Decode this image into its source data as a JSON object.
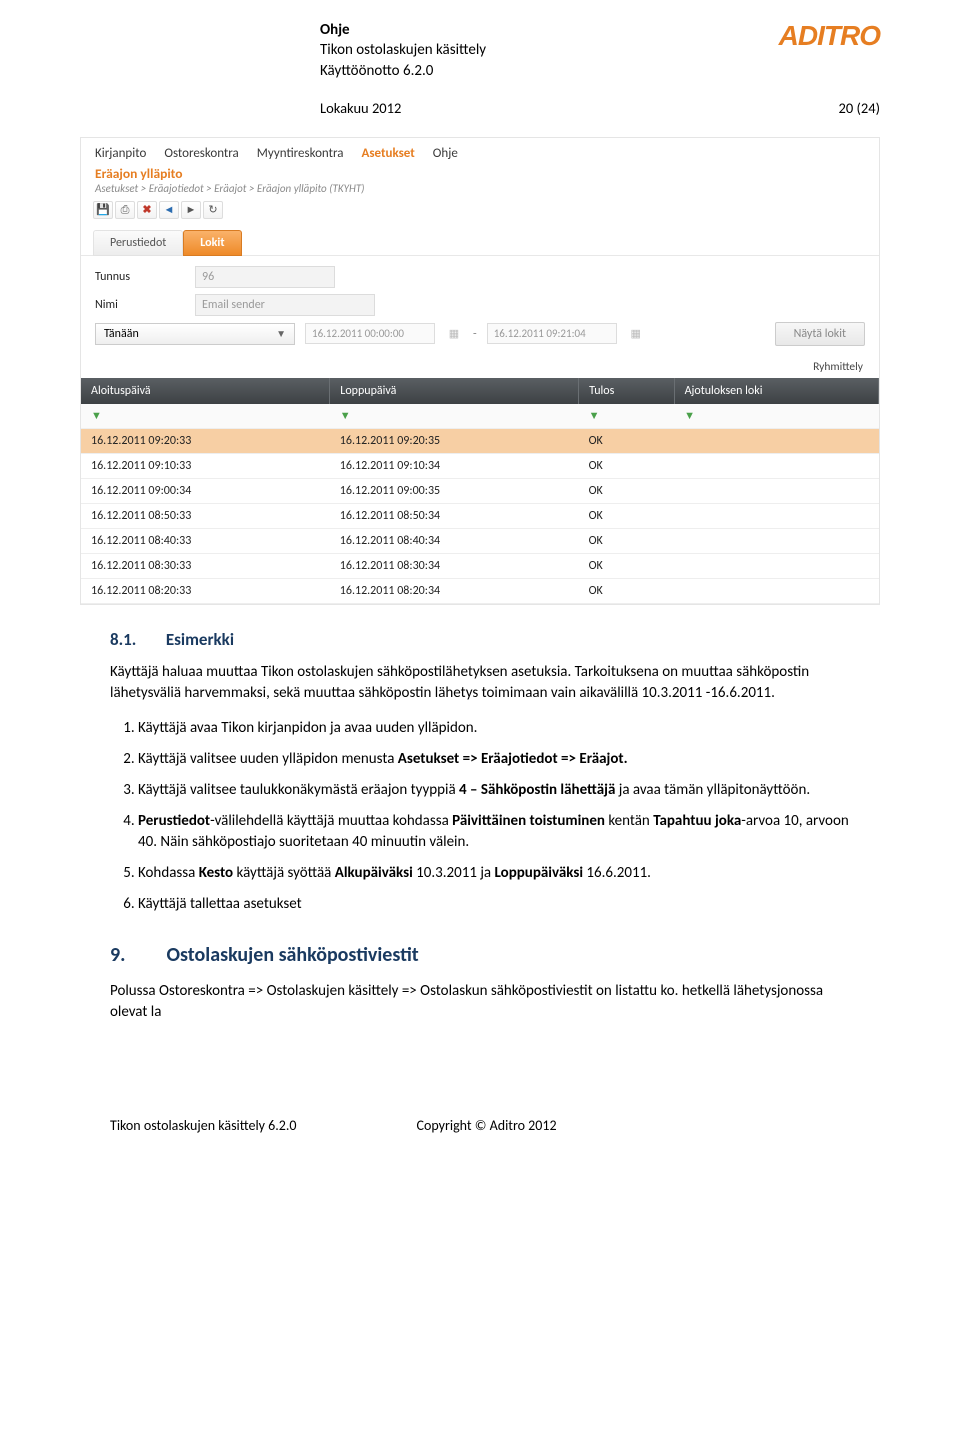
{
  "header": {
    "title": "Ohje",
    "line2": "Tikon ostolaskujen käsittely",
    "line3": "Käyttöönotto 6.2.0",
    "logo": "ADITRO",
    "date": "Lokakuu 2012",
    "pagenum": "20 (24)"
  },
  "app": {
    "menu": [
      "Kirjanpito",
      "Ostoreskontra",
      "Myyntireskontra",
      "Asetukset",
      "Ohje"
    ],
    "active_menu": "Asetukset",
    "screen_title": "Eräajon ylläpito",
    "breadcrumb": "Asetukset > Eräajotiedot > Eräajot > Eräajon ylläpito  (TKYHT)",
    "tabs": {
      "inactive": "Perustiedot",
      "active": "Lokit"
    },
    "form": {
      "tunnus_label": "Tunnus",
      "tunnus_value": "96",
      "nimi_label": "Nimi",
      "nimi_value": "Email sender",
      "range_option": "Tänään",
      "dt_from": "16.12.2011 00:00:00",
      "dt_to": "16.12.2011 09:21:04",
      "dash": "-",
      "show_button": "Näytä lokit",
      "grouping": "Ryhmittely"
    },
    "columns": [
      "Aloituspäivä",
      "Loppupäivä",
      "Tulos",
      "Ajotuloksen loki"
    ],
    "rows": [
      {
        "start": "16.12.2011 09:20:33",
        "end": "16.12.2011 09:20:35",
        "result": "OK",
        "selected": true
      },
      {
        "start": "16.12.2011 09:10:33",
        "end": "16.12.2011 09:10:34",
        "result": "OK"
      },
      {
        "start": "16.12.2011 09:00:34",
        "end": "16.12.2011 09:00:35",
        "result": "OK"
      },
      {
        "start": "16.12.2011 08:50:33",
        "end": "16.12.2011 08:50:34",
        "result": "OK"
      },
      {
        "start": "16.12.2011 08:40:33",
        "end": "16.12.2011 08:40:34",
        "result": "OK"
      },
      {
        "start": "16.12.2011 08:30:33",
        "end": "16.12.2011 08:30:34",
        "result": "OK"
      },
      {
        "start": "16.12.2011 08:20:33",
        "end": "16.12.2011 08:20:34",
        "result": "OK"
      }
    ]
  },
  "sections": {
    "s81_num": "8.1.",
    "s81_title": "Esimerkki",
    "s81_intro": "Käyttäjä haluaa muuttaa Tikon ostolaskujen sähköpostilähetyksen asetuksia. Tarkoituksena on muuttaa sähköpostin lähetysväliä harvemmaksi, sekä muuttaa sähköpostin lähetys toimimaan vain aikavälillä 10.3.2011 -16.6.2011.",
    "steps": [
      {
        "pre": "Käyttäjä avaa Tikon kirjanpidon ja avaa uuden ylläpidon."
      },
      {
        "pre": "Käyttäjä valitsee uuden ylläpidon menusta ",
        "b1": "Asetukset => Eräajotiedot => Eräajot.",
        "post": ""
      },
      {
        "pre": "Käyttäjä valitsee taulukkonäkymästä eräajon tyyppiä ",
        "b1": "4 – Sähköpostin lähettäjä",
        "post": " ja avaa tämän ylläpitonäyttöön."
      },
      {
        "b1": "Perustiedot",
        "mid1": "-välilehdellä käyttäjä muuttaa kohdassa ",
        "b2": "Päivittäinen  toistuminen",
        "mid2": " kentän ",
        "b3": "Tapahtuu joka",
        "post": "-arvoa 10, arvoon 40. Näin sähköpostiajo suoritetaan 40 minuutin välein."
      },
      {
        "pre": "Kohdassa ",
        "b1": "Kesto",
        "mid1": " käyttäjä syöttää ",
        "b2": "Alkupäiväksi",
        "mid2": " 10.3.2011 ja ",
        "b3": "Loppupäiväksi",
        "post": " 16.6.2011."
      },
      {
        "pre": "Käyttäjä tallettaa asetukset"
      }
    ],
    "s9_num": "9.",
    "s9_title": "Ostolaskujen sähköpostiviestit",
    "s9_body": "Polussa Ostoreskontra => Ostolaskujen käsittely => Ostolaskun sähköpostiviestit on listattu ko. hetkellä lähetysjonossa olevat la"
  },
  "footer": {
    "left": "Tikon ostolaskujen käsittely 6.2.0",
    "right": "Copyright © Aditro 2012"
  }
}
